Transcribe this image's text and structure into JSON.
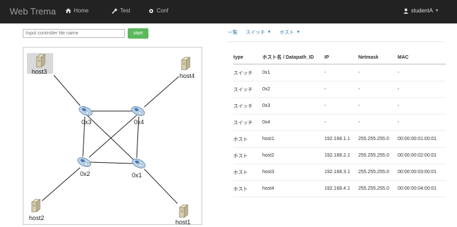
{
  "nav": {
    "brand": "Web Trema",
    "items": [
      {
        "label": "Home",
        "icon": "home-icon"
      },
      {
        "label": "Test",
        "icon": "wrench-icon"
      },
      {
        "label": "Conf",
        "icon": "gear-icon"
      }
    ],
    "user": {
      "label": "studentA",
      "icon": "user-icon"
    }
  },
  "controls": {
    "file_input": {
      "placeholder": "Input controller file name",
      "value": ""
    },
    "start_label": "start"
  },
  "topology": {
    "switches": [
      "0x1",
      "0x2",
      "0x3",
      "0x4"
    ],
    "hosts": [
      "host1",
      "host2",
      "host3",
      "host4"
    ]
  },
  "tabs": [
    {
      "label": "一覧"
    },
    {
      "label": "スイッチ"
    },
    {
      "label": "ホスト"
    }
  ],
  "table": {
    "headers": [
      "type",
      "ホスト名 / Datapath_ID",
      "IP",
      "Netmask",
      "MAC"
    ],
    "rows": [
      [
        "スイッチ",
        "0x1",
        "-",
        "-",
        "-"
      ],
      [
        "スイッチ",
        "0x2",
        "-",
        "-",
        "-"
      ],
      [
        "スイッチ",
        "0x3",
        "-",
        "-",
        "-"
      ],
      [
        "スイッチ",
        "0x4",
        "-",
        "-",
        "-"
      ],
      [
        "ホスト",
        "host1",
        "192.168.1.1",
        "255.255.255.0",
        "00:00:00:01:00:01"
      ],
      [
        "ホスト",
        "host2",
        "192.168.2.1",
        "255.255.255.0",
        "00:00:00:02:00:01"
      ],
      [
        "ホスト",
        "host3",
        "192.168.3.1",
        "255.255.255.0",
        "00:00:00:03:00:01"
      ],
      [
        "ホスト",
        "host4",
        "192.168.4.1",
        "255.255.255.0",
        "00:00:00:04:00:01"
      ]
    ]
  },
  "colors": {
    "navbar": "#222222",
    "link": "#337ab7",
    "start_button": "#5cb85c"
  }
}
